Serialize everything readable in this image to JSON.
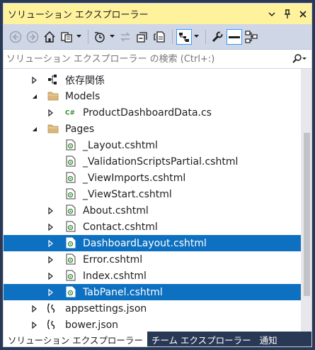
{
  "window": {
    "title": "ソリューション エクスプローラー",
    "menu_icon": "chevron-down-icon",
    "pin_icon": "pin-icon",
    "close_icon": "close-icon"
  },
  "toolbar": {
    "buttons": [
      {
        "name": "back-button",
        "icon": "back-arrow-icon"
      },
      {
        "name": "forward-button",
        "icon": "forward-arrow-icon"
      },
      {
        "name": "home-button",
        "icon": "home-icon"
      },
      {
        "name": "switch-views-button",
        "icon": "switch-views-icon"
      },
      {
        "name": "pending-changes-filter-button",
        "icon": "history-clock-icon"
      },
      {
        "name": "sync-button",
        "icon": "sync-arrows-icon"
      },
      {
        "name": "collapse-all-button",
        "icon": "collapse-all-icon"
      },
      {
        "name": "show-all-files-button",
        "icon": "show-all-files-icon"
      },
      {
        "name": "preview-button",
        "icon": "preview-selected-icon"
      },
      {
        "name": "properties-button",
        "icon": "wrench-icon"
      },
      {
        "name": "show-properties-button",
        "icon": "properties-icon"
      },
      {
        "name": "class-diagram-button",
        "icon": "class-diagram-icon"
      }
    ]
  },
  "search": {
    "placeholder": "ソリューション エクスプローラー の検索 (Ctrl+:)",
    "icon": "search-icon"
  },
  "tree": {
    "items": [
      {
        "label": "依存関係",
        "type": "dependencies",
        "level": 0,
        "expander": "collapsed",
        "selected": false
      },
      {
        "label": "Models",
        "type": "folder",
        "level": 0,
        "expander": "expanded",
        "selected": false
      },
      {
        "label": "ProductDashboardData.cs",
        "type": "csharp",
        "level": 1,
        "expander": "collapsed",
        "selected": false
      },
      {
        "label": "Pages",
        "type": "folder",
        "level": 0,
        "expander": "expanded",
        "selected": false
      },
      {
        "label": "_Layout.cshtml",
        "type": "razor",
        "level": 1,
        "expander": "none",
        "selected": false
      },
      {
        "label": "_ValidationScriptsPartial.cshtml",
        "type": "razor",
        "level": 1,
        "expander": "none",
        "selected": false
      },
      {
        "label": "_ViewImports.cshtml",
        "type": "razor",
        "level": 1,
        "expander": "none",
        "selected": false
      },
      {
        "label": "_ViewStart.cshtml",
        "type": "razor",
        "level": 1,
        "expander": "none",
        "selected": false
      },
      {
        "label": "About.cshtml",
        "type": "razor",
        "level": 1,
        "expander": "collapsed",
        "selected": false
      },
      {
        "label": "Contact.cshtml",
        "type": "razor",
        "level": 1,
        "expander": "collapsed",
        "selected": false
      },
      {
        "label": "DashboardLayout.cshtml",
        "type": "razor",
        "level": 1,
        "expander": "collapsed",
        "selected": true
      },
      {
        "label": "Error.cshtml",
        "type": "razor",
        "level": 1,
        "expander": "collapsed",
        "selected": false
      },
      {
        "label": "Index.cshtml",
        "type": "razor",
        "level": 1,
        "expander": "collapsed",
        "selected": false
      },
      {
        "label": "TabPanel.cshtml",
        "type": "razor",
        "level": 1,
        "expander": "collapsed",
        "selected": true
      },
      {
        "label": "appsettings.json",
        "type": "json",
        "level": 0,
        "expander": "collapsed",
        "selected": false
      },
      {
        "label": "bower.json",
        "type": "json",
        "level": 0,
        "expander": "collapsed",
        "selected": false
      }
    ]
  },
  "tabs": [
    {
      "label": "ソリューション エクスプローラー",
      "active": true
    },
    {
      "label": "チーム エクスプローラー",
      "active": false
    },
    {
      "label": "通知",
      "active": false
    }
  ],
  "colors": {
    "title_bar": "#fff29d",
    "toolbar": "#cfd6e5",
    "selection": "#0e70c0",
    "frame": "#293955"
  }
}
